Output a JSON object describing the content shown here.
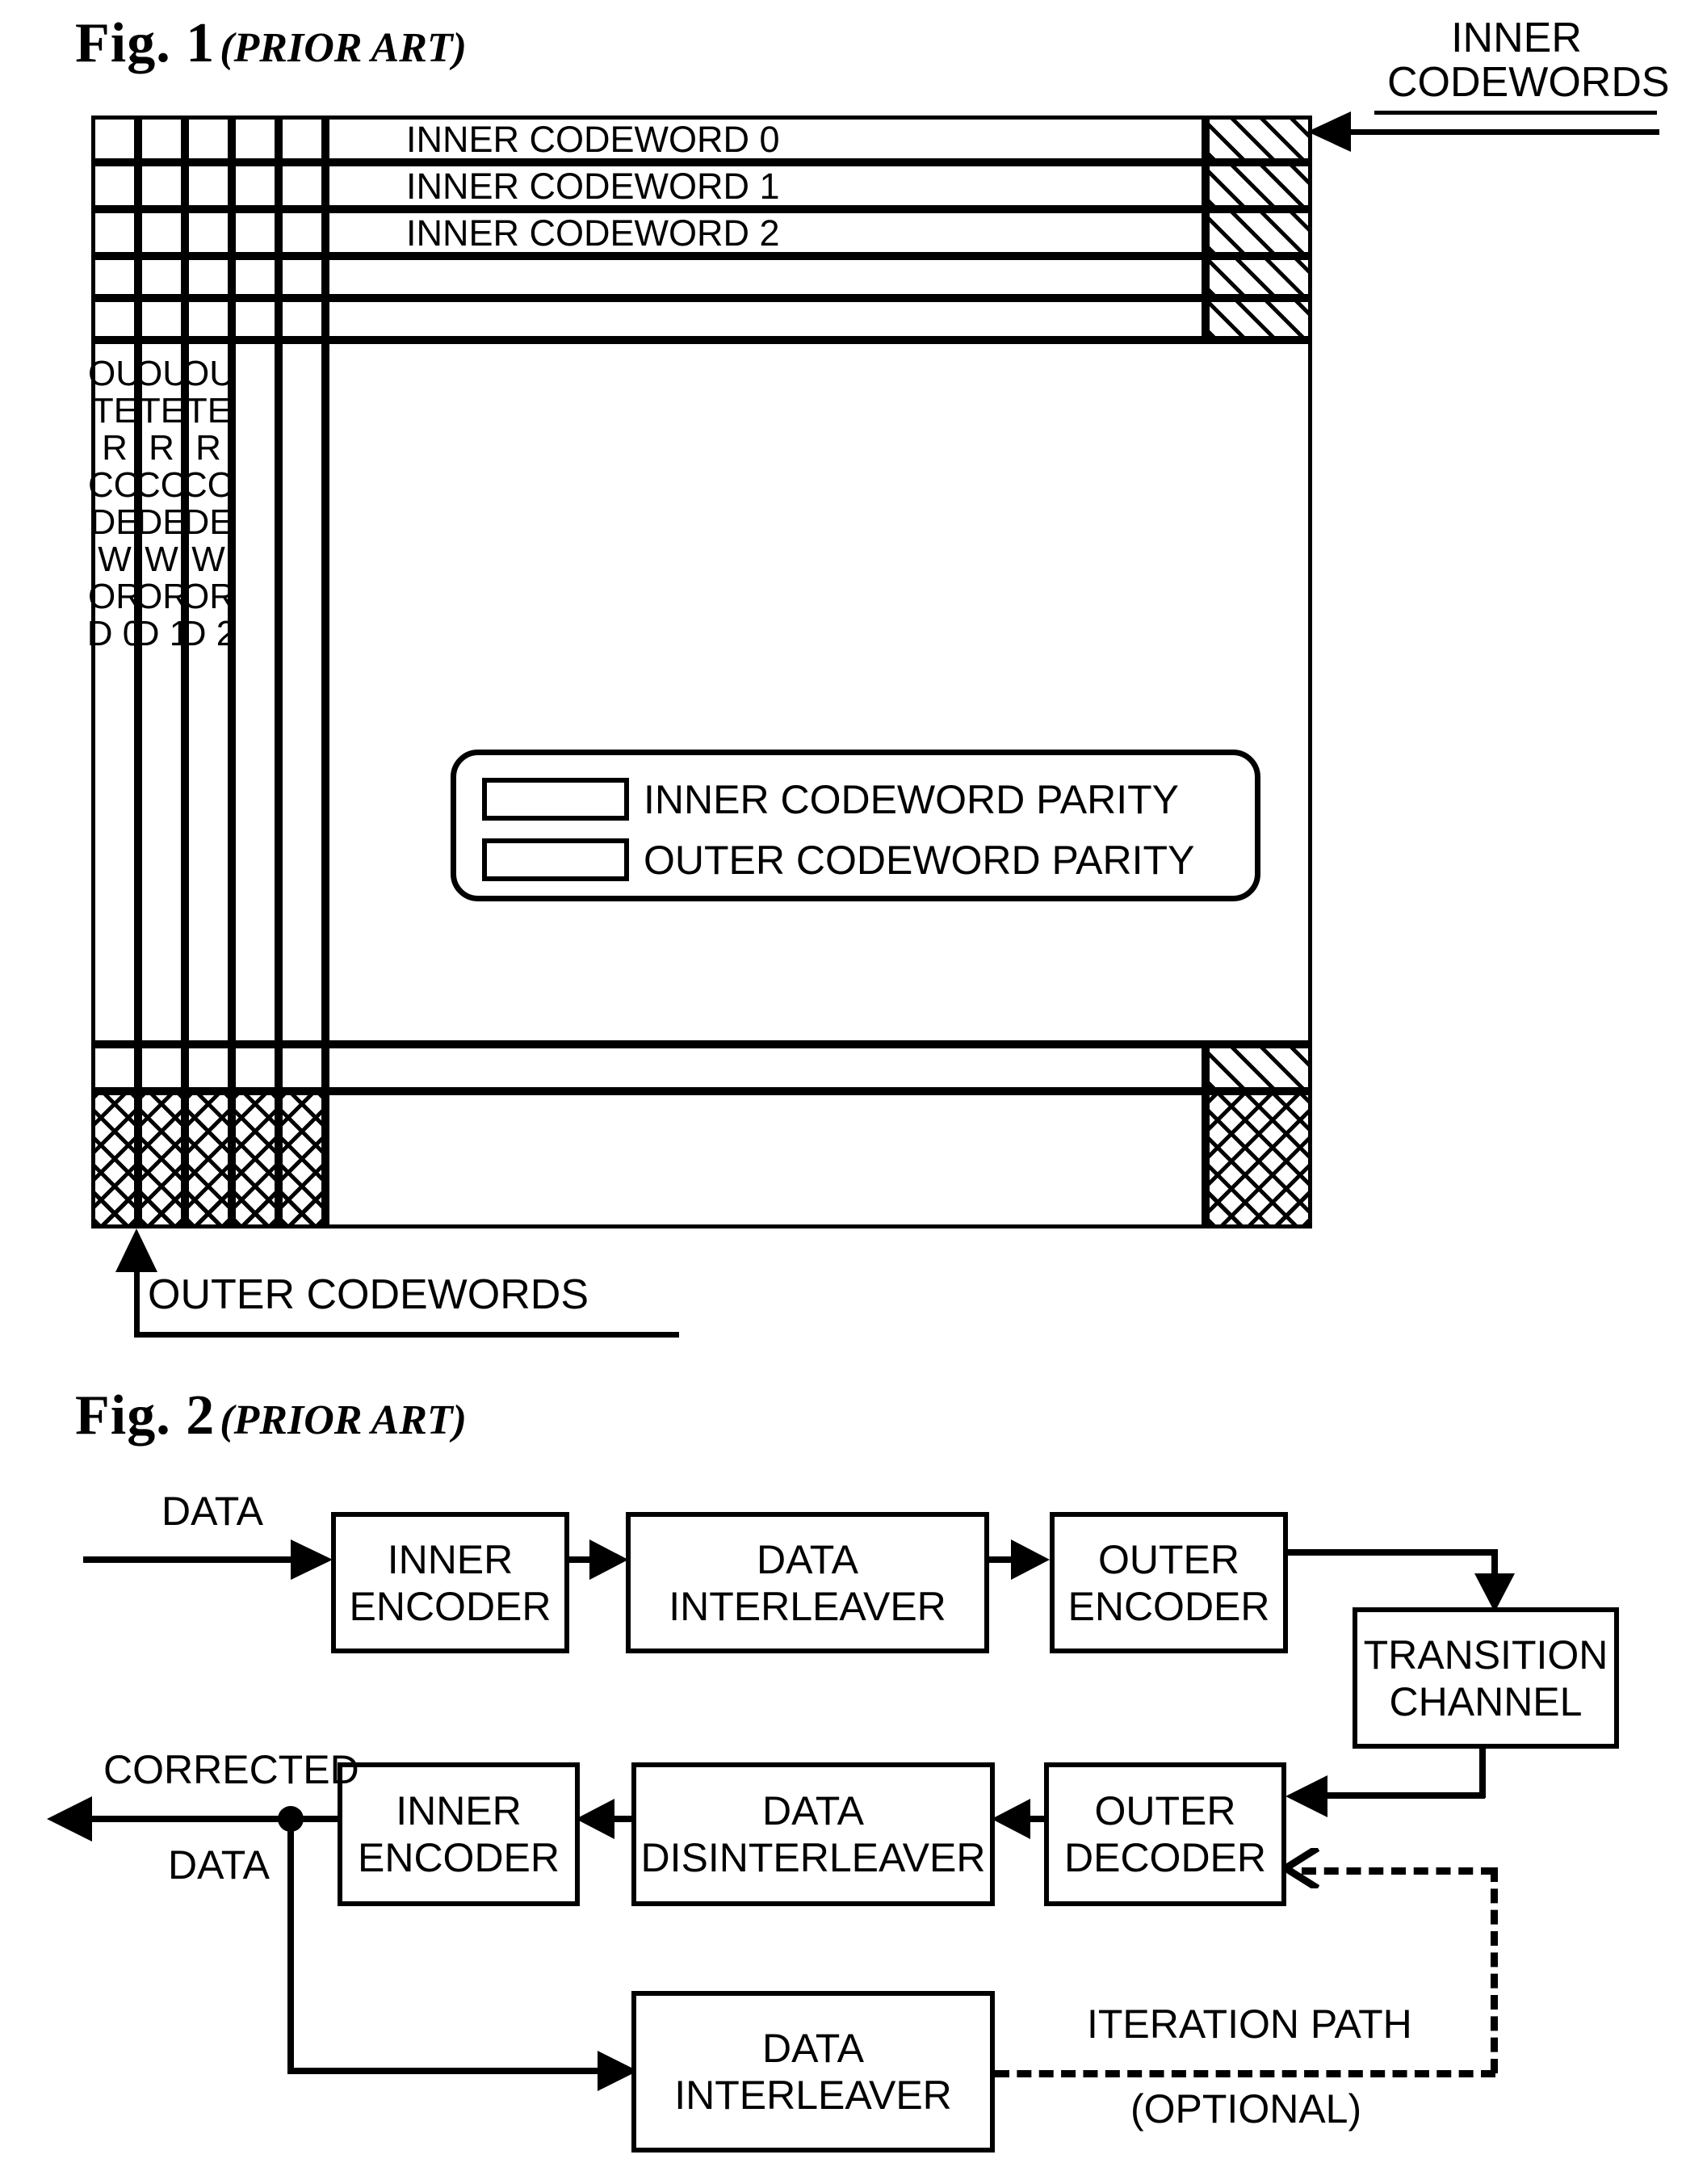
{
  "figures": [
    {
      "id": "fig1",
      "number": "Fig.  1",
      "prior_art": "(PRIOR ART)",
      "inner_rows": [
        "INNER CODEWORD 0",
        "INNER CODEWORD 1",
        "INNER CODEWORD 2"
      ],
      "outer_columns": [
        "OUTER CODEWORD 0",
        "OUTER CODEWORD 1",
        "OUTER CODEWORD 2"
      ],
      "outer_column_glyphs": [
        {
          "word": "OUTER CODEWORD",
          "index": "0"
        },
        {
          "word": "OUTER CODEWORD",
          "index": "1"
        },
        {
          "word": "OUTER CODEWORD",
          "index": "2"
        }
      ],
      "legend": {
        "items": [
          {
            "swatch": "diagonal-hatch",
            "label": "INNER CODEWORD PARITY"
          },
          {
            "swatch": "cross-hatch",
            "label": "OUTER CODEWORD PARITY"
          }
        ]
      },
      "callouts": {
        "inner": "INNER\nCODEWORDS",
        "inner_line1": "INNER",
        "inner_line2": "CODEWORDS",
        "outer": "OUTER CODEWORDS"
      }
    },
    {
      "id": "fig2",
      "number": "Fig.  2",
      "prior_art": "(PRIOR ART)",
      "blocks": [
        {
          "key": "inner_encoder_tx",
          "line1": "INNER",
          "line2": "ENCODER"
        },
        {
          "key": "data_interleaver_tx",
          "line1": "DATA",
          "line2": "INTERLEAVER"
        },
        {
          "key": "outer_encoder",
          "line1": "OUTER",
          "line2": "ENCODER"
        },
        {
          "key": "transition_channel",
          "line1": "TRANSITION",
          "line2": "CHANNEL"
        },
        {
          "key": "outer_decoder",
          "line1": "OUTER",
          "line2": "DECODER"
        },
        {
          "key": "data_disinterleaver",
          "line1": "DATA",
          "line2": "DISINTERLEAVER"
        },
        {
          "key": "inner_encoder_rx",
          "line1": "INNER",
          "line2": "ENCODER"
        },
        {
          "key": "data_interleaver_fb",
          "line1": "DATA",
          "line2": "INTERLEAVER"
        }
      ],
      "labels": {
        "data_in": "DATA",
        "corrected": "CORRECTED",
        "corrected_data": "DATA",
        "iteration_path": "ITERATION PATH",
        "iteration_optional": "(OPTIONAL)"
      }
    }
  ],
  "colors": {
    "ink": "#000000",
    "paper": "#ffffff"
  }
}
